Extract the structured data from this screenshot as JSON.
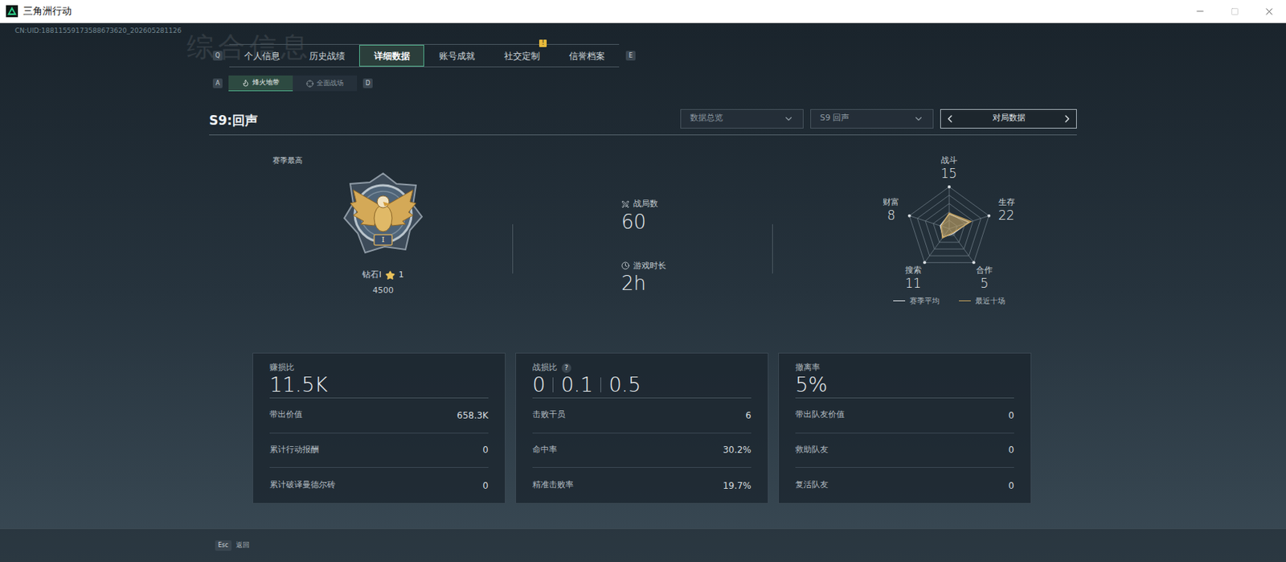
{
  "window": {
    "title": "三角洲行动"
  },
  "uid": "CN:UID:18811559173588673620_202605281126",
  "watermark": "综合信息",
  "tabs": {
    "prev_key": "Q",
    "next_key": "E",
    "items": [
      {
        "label": "个人信息",
        "selected": false,
        "badge": ""
      },
      {
        "label": "历史战绩",
        "selected": false,
        "badge": ""
      },
      {
        "label": "详细数据",
        "selected": true,
        "badge": ""
      },
      {
        "label": "账号成就",
        "selected": false,
        "badge": ""
      },
      {
        "label": "社交定制",
        "selected": false,
        "badge": "!"
      },
      {
        "label": "信誉档案",
        "selected": false,
        "badge": ""
      }
    ]
  },
  "subtabs": {
    "prev_key": "A",
    "next_key": "D",
    "items": [
      {
        "label": "烽火地带",
        "selected": true
      },
      {
        "label": "全面战场",
        "selected": false
      }
    ]
  },
  "season_title": "S9:回声",
  "filters": [
    {
      "label": "数据总览"
    },
    {
      "label": "S9 回声"
    }
  ],
  "pager": {
    "label": "对局数据"
  },
  "rank": {
    "heading": "赛季最高",
    "numeral": "I",
    "name": "钻石I",
    "stars": "1",
    "score": "4500"
  },
  "overview": [
    {
      "label": "战局数",
      "value": "60"
    },
    {
      "label": "游戏时长",
      "value": "2h"
    }
  ],
  "radar": {
    "axes": [
      {
        "label": "战斗",
        "value": "15"
      },
      {
        "label": "生存",
        "value": "22"
      },
      {
        "label": "合作",
        "value": "5"
      },
      {
        "label": "搜索",
        "value": "11"
      },
      {
        "label": "财富",
        "value": "8"
      }
    ],
    "series": [
      {
        "label": "赛季平均",
        "values": [
          14,
          20,
          6,
          10,
          9
        ],
        "color": "#e5e9ec"
      },
      {
        "label": "最近十场",
        "values": [
          15,
          22,
          5,
          11,
          8
        ],
        "color": "#c9a45c"
      }
    ]
  },
  "cards": [
    {
      "title": "赚损比",
      "help": "",
      "values": [
        "11.5K"
      ],
      "rows": [
        {
          "label": "带出价值",
          "value": "658.3K"
        },
        {
          "label": "累计行动报酬",
          "value": "0"
        },
        {
          "label": "累计破译曼德尔砖",
          "value": "0"
        }
      ]
    },
    {
      "title": "战损比",
      "help": "?",
      "values": [
        "0",
        "0.1",
        "0.5"
      ],
      "rows": [
        {
          "label": "击败干员",
          "value": "6"
        },
        {
          "label": "命中率",
          "value": "30.2%"
        },
        {
          "label": "精准击败率",
          "value": "19.7%"
        }
      ]
    },
    {
      "title": "撤离率",
      "help": "",
      "values": [
        "5%"
      ],
      "rows": [
        {
          "label": "带出队友价值",
          "value": "0"
        },
        {
          "label": "救助队友",
          "value": "0"
        },
        {
          "label": "复活队友",
          "value": "0"
        }
      ]
    }
  ],
  "footer": {
    "key": "Esc",
    "label": "返回"
  }
}
